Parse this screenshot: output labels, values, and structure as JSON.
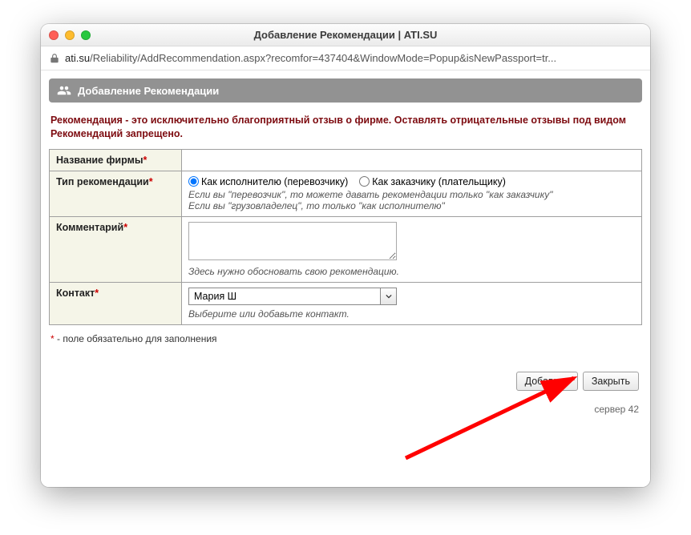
{
  "window": {
    "title": "Добавление Рекомендации | ATI.SU",
    "url_domain": "ati.su",
    "url_path": "/Reliability/AddRecommendation.aspx?recomfor=437404&WindowMode=Popup&isNewPassport=tr..."
  },
  "header": {
    "title": "Добавление Рекомендации"
  },
  "warning": "Рекомендация - это исключительно благоприятный отзыв о фирме. Оставлять отрицательные отзывы под видом Рекомендаций запрещено.",
  "form": {
    "company": {
      "label": "Название фирмы",
      "value": ""
    },
    "type": {
      "label": "Тип рекомендации",
      "option1": "Как исполнителю (перевозчику)",
      "option2": "Как заказчику (плательщику)",
      "selected": "option1",
      "hint1": "Если вы \"перевозчик\", то можете давать рекомендации только \"как заказчику\"",
      "hint2": "Если вы \"грузовладелец\", то только \"как исполнителю\""
    },
    "comment": {
      "label": "Комментарий",
      "value": "",
      "hint": "Здесь нужно обосновать свою рекомендацию."
    },
    "contact": {
      "label": "Контакт",
      "value": "Мария Ш",
      "hint": "Выберите или добавьте контакт."
    }
  },
  "footnote_star": "*",
  "footnote_text": " - поле обязательно для заполнения",
  "buttons": {
    "add": "Добавить",
    "close": "Закрыть"
  },
  "server": "сервер 42"
}
